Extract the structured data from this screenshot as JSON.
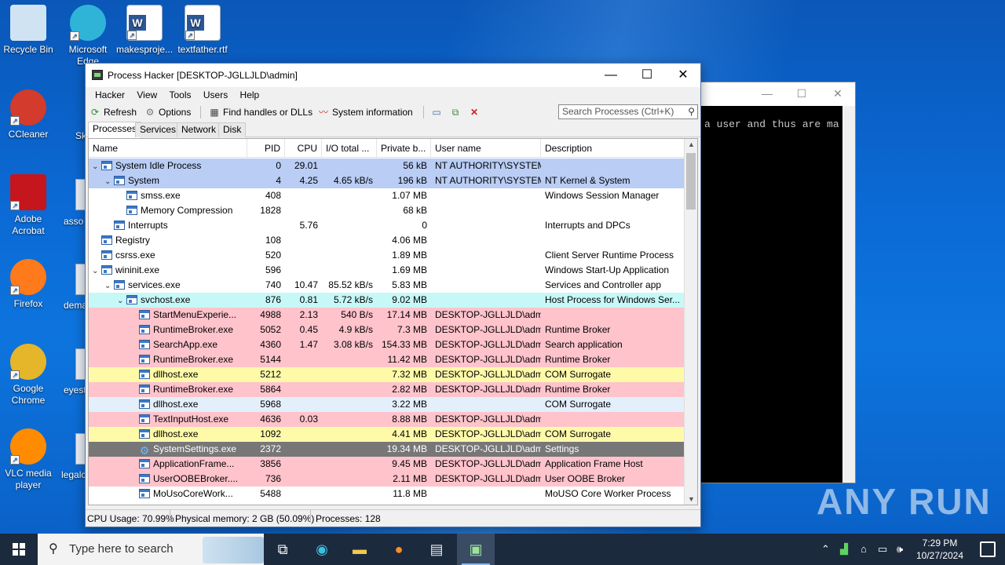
{
  "desktop": {
    "icons": [
      {
        "label": "Recycle Bin",
        "icon": "recycle-bin-icon"
      },
      {
        "label": "Microsoft Edge",
        "icon": "edge-icon"
      },
      {
        "label": "makesproje...",
        "icon": "word-doc-icon"
      },
      {
        "label": "textfather.rtf",
        "icon": "word-doc-icon"
      },
      {
        "label": "CCleaner",
        "icon": "ccleaner-icon"
      },
      {
        "label": "Adobe Acrobat",
        "icon": "acrobat-icon"
      },
      {
        "label": "Firefox",
        "icon": "firefox-icon"
      },
      {
        "label": "Google Chrome",
        "icon": "chrome-icon"
      },
      {
        "label": "VLC media player",
        "icon": "vlc-icon"
      }
    ],
    "partial_labels": [
      "Sk",
      "asso",
      "dema",
      "eyest",
      "legalc"
    ]
  },
  "console": {
    "text": "a user and thus are ma"
  },
  "process_hacker": {
    "title": "Process Hacker [DESKTOP-JGLLJLD\\admin]",
    "window_buttons": {
      "minimize": "—",
      "maximize": "☐",
      "close": "✕"
    },
    "menu": [
      "Hacker",
      "View",
      "Tools",
      "Users",
      "Help"
    ],
    "toolbar": {
      "refresh": "Refresh",
      "options": "Options",
      "find_handles": "Find handles or DLLs",
      "system_info": "System information"
    },
    "search_placeholder": "Search Processes (Ctrl+K)",
    "tabs": [
      "Processes",
      "Services",
      "Network",
      "Disk"
    ],
    "columns": [
      "Name",
      "PID",
      "CPU",
      "I/O total ...",
      "Private b...",
      "User name",
      "Description"
    ],
    "rows": [
      {
        "depth": 0,
        "tw": "⌄",
        "name": "System Idle Process",
        "pid": "0",
        "cpu": "29.01",
        "io": "",
        "pb": "56 kB",
        "user": "NT AUTHORITY\\SYSTEM",
        "desc": "",
        "bg": "#b9cdf5"
      },
      {
        "depth": 1,
        "tw": "⌄",
        "name": "System",
        "pid": "4",
        "cpu": "4.25",
        "io": "4.65 kB/s",
        "pb": "196 kB",
        "user": "NT AUTHORITY\\SYSTEM",
        "desc": "NT Kernel & System",
        "bg": "#b9cdf5"
      },
      {
        "depth": 2,
        "tw": "",
        "name": "smss.exe",
        "pid": "408",
        "cpu": "",
        "io": "",
        "pb": "1.07 MB",
        "user": "",
        "desc": "Windows Session Manager",
        "bg": "#ffffff"
      },
      {
        "depth": 2,
        "tw": "",
        "name": "Memory Compression",
        "pid": "1828",
        "cpu": "",
        "io": "",
        "pb": "68 kB",
        "user": "",
        "desc": "",
        "bg": "#ffffff"
      },
      {
        "depth": 1,
        "tw": "",
        "name": "Interrupts",
        "pid": "",
        "cpu": "5.76",
        "io": "",
        "pb": "0",
        "user": "",
        "desc": "Interrupts and DPCs",
        "bg": "#ffffff"
      },
      {
        "depth": 0,
        "tw": "",
        "name": "Registry",
        "pid": "108",
        "cpu": "",
        "io": "",
        "pb": "4.06 MB",
        "user": "",
        "desc": "",
        "bg": "#ffffff"
      },
      {
        "depth": 0,
        "tw": "",
        "name": "csrss.exe",
        "pid": "520",
        "cpu": "",
        "io": "",
        "pb": "1.89 MB",
        "user": "",
        "desc": "Client Server Runtime Process",
        "bg": "#ffffff"
      },
      {
        "depth": 0,
        "tw": "⌄",
        "name": "wininit.exe",
        "pid": "596",
        "cpu": "",
        "io": "",
        "pb": "1.69 MB",
        "user": "",
        "desc": "Windows Start-Up Application",
        "bg": "#ffffff"
      },
      {
        "depth": 1,
        "tw": "⌄",
        "name": "services.exe",
        "pid": "740",
        "cpu": "10.47",
        "io": "85.52 kB/s",
        "pb": "5.83 MB",
        "user": "",
        "desc": "Services and Controller app",
        "bg": "#ffffff"
      },
      {
        "depth": 2,
        "tw": "⌄",
        "name": "svchost.exe",
        "pid": "876",
        "cpu": "0.81",
        "io": "5.72 kB/s",
        "pb": "9.02 MB",
        "user": "",
        "desc": "Host Process for Windows Ser...",
        "bg": "#c6f8f8"
      },
      {
        "depth": 3,
        "tw": "",
        "name": "StartMenuExperie...",
        "pid": "4988",
        "cpu": "2.13",
        "io": "540 B/s",
        "pb": "17.14 MB",
        "user": "DESKTOP-JGLLJLD\\admi",
        "desc": "",
        "bg": "#ffc3cc"
      },
      {
        "depth": 3,
        "tw": "",
        "name": "RuntimeBroker.exe",
        "pid": "5052",
        "cpu": "0.45",
        "io": "4.9 kB/s",
        "pb": "7.3 MB",
        "user": "DESKTOP-JGLLJLD\\admi",
        "desc": "Runtime Broker",
        "bg": "#ffc3cc"
      },
      {
        "depth": 3,
        "tw": "",
        "name": "SearchApp.exe",
        "pid": "4360",
        "cpu": "1.47",
        "io": "3.08 kB/s",
        "pb": "154.33 MB",
        "user": "DESKTOP-JGLLJLD\\admi",
        "desc": "Search application",
        "bg": "#ffc3cc"
      },
      {
        "depth": 3,
        "tw": "",
        "name": "RuntimeBroker.exe",
        "pid": "5144",
        "cpu": "",
        "io": "",
        "pb": "11.42 MB",
        "user": "DESKTOP-JGLLJLD\\admi",
        "desc": "Runtime Broker",
        "bg": "#ffc3cc"
      },
      {
        "depth": 3,
        "tw": "",
        "name": "dllhost.exe",
        "pid": "5212",
        "cpu": "",
        "io": "",
        "pb": "7.32 MB",
        "user": "DESKTOP-JGLLJLD\\admi",
        "desc": "COM Surrogate",
        "bg": "#fffaa8"
      },
      {
        "depth": 3,
        "tw": "",
        "name": "RuntimeBroker.exe",
        "pid": "5864",
        "cpu": "",
        "io": "",
        "pb": "2.82 MB",
        "user": "DESKTOP-JGLLJLD\\admi",
        "desc": "Runtime Broker",
        "bg": "#ffc3cc"
      },
      {
        "depth": 3,
        "tw": "",
        "name": "dllhost.exe",
        "pid": "5968",
        "cpu": "",
        "io": "",
        "pb": "3.22 MB",
        "user": "",
        "desc": "COM Surrogate",
        "bg": "#e4effc"
      },
      {
        "depth": 3,
        "tw": "",
        "name": "TextInputHost.exe",
        "pid": "4636",
        "cpu": "0.03",
        "io": "",
        "pb": "8.88 MB",
        "user": "DESKTOP-JGLLJLD\\admi",
        "desc": "",
        "bg": "#ffc3cc"
      },
      {
        "depth": 3,
        "tw": "",
        "name": "dllhost.exe",
        "pid": "1092",
        "cpu": "",
        "io": "",
        "pb": "4.41 MB",
        "user": "DESKTOP-JGLLJLD\\admi",
        "desc": "COM Surrogate",
        "bg": "#fffaa8"
      },
      {
        "depth": 3,
        "tw": "",
        "name": "SystemSettings.exe",
        "pid": "2372",
        "cpu": "",
        "io": "",
        "pb": "19.34 MB",
        "user": "DESKTOP-JGLLJLD\\admi",
        "desc": "Settings",
        "bg": "#777777",
        "fg": "#ffffff",
        "gear": true
      },
      {
        "depth": 3,
        "tw": "",
        "name": "ApplicationFrame...",
        "pid": "3856",
        "cpu": "",
        "io": "",
        "pb": "9.45 MB",
        "user": "DESKTOP-JGLLJLD\\admi",
        "desc": "Application Frame Host",
        "bg": "#ffc3cc"
      },
      {
        "depth": 3,
        "tw": "",
        "name": "UserOOBEBroker....",
        "pid": "736",
        "cpu": "",
        "io": "",
        "pb": "2.11 MB",
        "user": "DESKTOP-JGLLJLD\\admi",
        "desc": "User OOBE Broker",
        "bg": "#ffc3cc"
      },
      {
        "depth": 3,
        "tw": "",
        "name": "MoUsoCoreWork...",
        "pid": "5488",
        "cpu": "",
        "io": "",
        "pb": "11.8 MB",
        "user": "",
        "desc": "MoUSO Core Worker Process",
        "bg": "#ffffff"
      }
    ],
    "status": {
      "cpu": "CPU Usage: 70.99%",
      "memory": "Physical memory: 2 GB (50.09%)",
      "processes": "Processes: 128"
    }
  },
  "taskbar": {
    "search_placeholder": "Type here to search",
    "time": "7:29 PM",
    "date": "10/27/2024"
  },
  "watermark": "ANY RUN"
}
